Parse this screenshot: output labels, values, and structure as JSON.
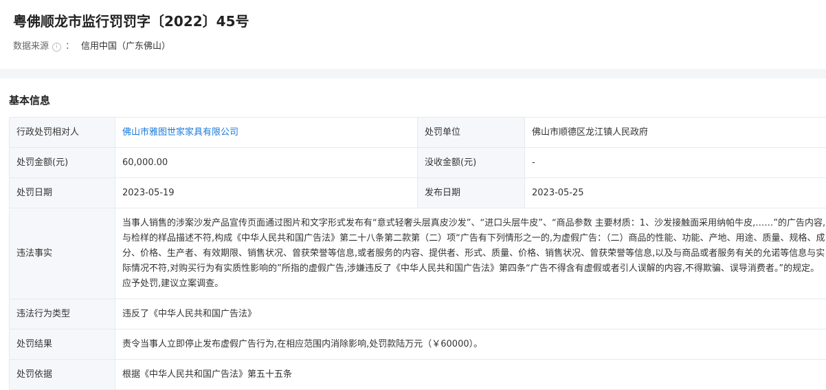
{
  "page": {
    "title": "粤佛顺龙市监行罚罚字〔2022〕45号",
    "source_label": "数据来源",
    "source_colon": "：",
    "source_value": "信用中国（广东佛山）"
  },
  "section": {
    "title": "基本信息"
  },
  "table": {
    "party_label": "行政处罚相对人",
    "party_value": "佛山市雅图世家家具有限公司",
    "unit_label": "处罚单位",
    "unit_value": "佛山市顺德区龙江镇人民政府",
    "amount_label": "处罚金额(元)",
    "amount_value": "60,000.00",
    "confiscated_label": "没收金额(元)",
    "confiscated_value": "-",
    "penalty_date_label": "处罚日期",
    "penalty_date_value": "2023-05-19",
    "publish_date_label": "发布日期",
    "publish_date_value": "2023-05-25",
    "facts_label": "违法事实",
    "facts_value": "当事人销售的涉案沙发产品宣传页面通过图片和文字形式发布有“意式轻奢头层真皮沙发”、“进口头层牛皮”、“商品参数 主要材质：1、沙发接触面采用纳帕牛皮,……”的广告内容,与检样的样品描述不符,构成《中华人民共和国广告法》第二十八条第二款第（二）项“广告有下列情形之一的,为虚假广告：（二）商品的性能、功能、产地、用途、质量、规格、成分、价格、生产者、有效期限、销售状况、曾获荣誉等信息,或者服务的内容、提供者、形式、质量、价格、销售状况、曾获荣誉等信息,以及与商品或者服务有关的允诺等信息与实际情况不符,对购买行为有实质性影响的”所指的虚假广告,涉嫌违反了《中华人民共和国广告法》第四条“广告不得含有虚假或者引人误解的内容,不得欺骗、误导消费者。”的规定。应予处罚,建议立案调查。",
    "type_label": "违法行为类型",
    "type_value": "违反了《中华人民共和国广告法》",
    "result_label": "处罚结果",
    "result_value": "责令当事人立即停止发布虚假广告行为,在相应范围内消除影响,处罚款陆万元（￥60000）。",
    "basis_label": "处罚依据",
    "basis_value": "根据《中华人民共和国广告法》第五十五条"
  },
  "colors": {
    "link": "#1a7ad8",
    "label_bg": "#f5f7fa",
    "border": "#e6e9ee",
    "band": "#f4f5f7"
  },
  "icons": {
    "info": "info-circle-icon"
  }
}
